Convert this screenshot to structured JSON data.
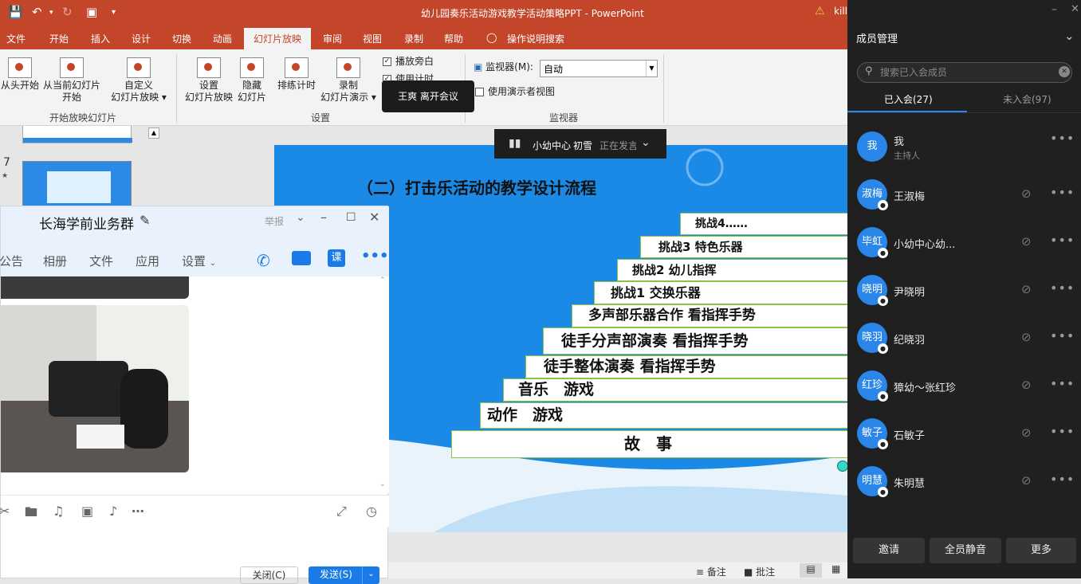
{
  "ppt": {
    "doc_title": "幼儿园奏乐活动游戏教学活动策略PPT  -  PowerPoint",
    "warn_text": "kill",
    "menu": [
      "文件",
      "开始",
      "插入",
      "设计",
      "切换",
      "动画",
      "幻灯片放映",
      "审阅",
      "视图",
      "录制",
      "帮助",
      "操作说明搜索"
    ],
    "ribbon": {
      "from_start": "从头开始",
      "from_current_1": "从当前幻灯片",
      "from_current_2": "开始",
      "custom_1": "自定义",
      "custom_2": "幻灯片放映",
      "group_start": "开始放映幻灯片",
      "setup_1": "设置",
      "setup_2": "幻灯片放映",
      "hide_1": "隐藏",
      "hide_2": "幻灯片",
      "rehearse": "排练计时",
      "record_1": "录制",
      "record_2": "幻灯片演示",
      "play_narration": "播放旁白",
      "use_timing": "使用计时",
      "group_setup": "设置",
      "monitor_label": "监视器(M):",
      "monitor_value": "自动",
      "presenter_view": "使用演示者视图",
      "group_monitor": "监视器"
    },
    "thumb_number": "7",
    "status": {
      "notes": "备注",
      "comments": "批注"
    }
  },
  "slide": {
    "title": "（二）打击乐活动的教学设计流程",
    "steps": [
      "故　事",
      "动作　游戏",
      "音乐　游戏",
      "徒手整体演奏  看指挥手势",
      "徒手分声部演奏  看指挥手势",
      "多声部乐器合作 看指挥手势",
      "挑战1  交换乐器",
      "挑战2 幼儿指挥",
      "挑战3 特色乐器",
      "挑战4……"
    ]
  },
  "meeting": {
    "toast": "王爽 离开会议",
    "speaker_room": "小幼中心",
    "speaker_name": "初雪",
    "speaker_status": "正在发言"
  },
  "chat": {
    "group_name": "长海学前业务群",
    "report": "举报",
    "tabs": [
      "公告",
      "相册",
      "文件",
      "应用",
      "设置"
    ],
    "class_icon": "课",
    "close": "关闭(C)",
    "send": "发送(S)"
  },
  "panel": {
    "title": "成员管理",
    "search_placeholder": "搜索已入会成员",
    "tab_joined": "已入会(27)",
    "tab_notjoined": "未入会(97)",
    "members": [
      {
        "avatar": "我",
        "name": "我",
        "role": "主持人"
      },
      {
        "avatar": "淑梅",
        "name": "王淑梅"
      },
      {
        "avatar": "毕虹",
        "name": "小幼中心幼..."
      },
      {
        "avatar": "晓明",
        "name": "尹晓明"
      },
      {
        "avatar": "晓羽",
        "name": "纪晓羽"
      },
      {
        "avatar": "红珍",
        "name": "獐幼～张红珍"
      },
      {
        "avatar": "敏子",
        "name": "石敏子"
      },
      {
        "avatar": "明慧",
        "name": "朱明慧"
      }
    ],
    "invite": "邀请",
    "mute_all": "全员静音",
    "more": "更多"
  },
  "colors": {
    "ppt_red": "#c4462a",
    "slide_blue": "#1a8ae6",
    "panel_bg": "#202020",
    "avatar_blue": "#2a86e8",
    "step_border": "#8bc34a"
  }
}
